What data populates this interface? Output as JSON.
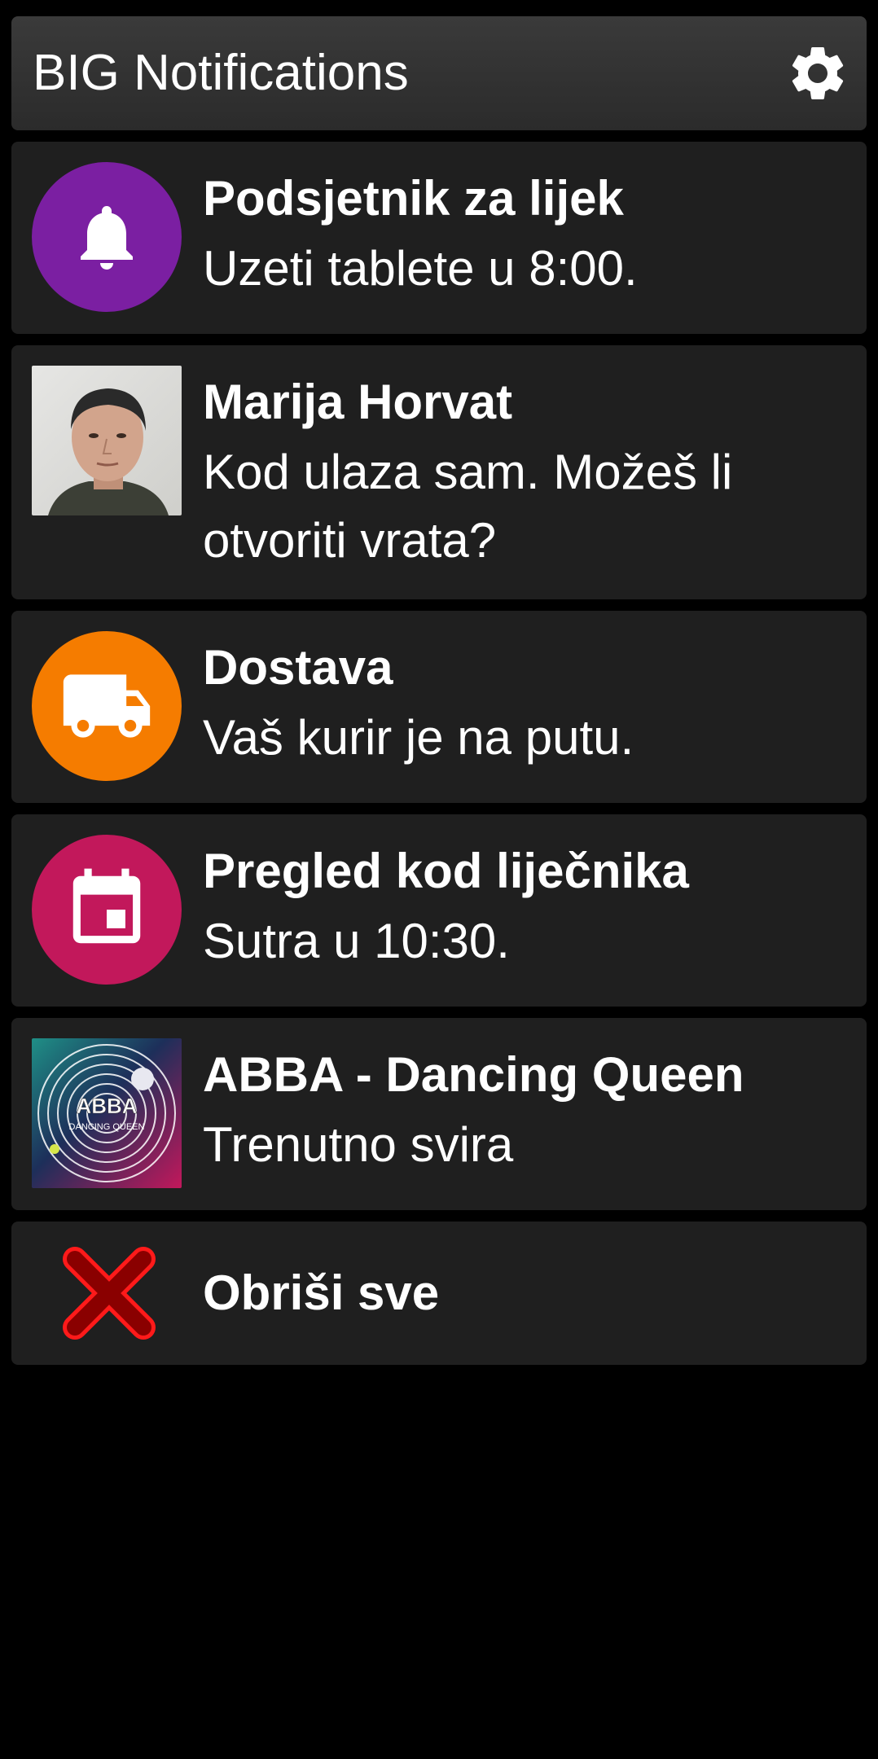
{
  "header": {
    "title": "BIG Notifications",
    "settings_icon": "gear-icon"
  },
  "notifications": [
    {
      "title": "Podsjetnik za lijek",
      "body": "Uzeti tablete u 8:00.",
      "icon": "bell-icon",
      "icon_color": "#7b1fa2"
    },
    {
      "title": "Marija Horvat",
      "body": "Kod ulaza sam. Možeš li otvoriti vrata?",
      "icon": "avatar-photo"
    },
    {
      "title": "Dostava",
      "body": "Vaš kurir je na putu.",
      "icon": "truck-icon",
      "icon_color": "#f57c00"
    },
    {
      "title": "Pregled kod liječnika",
      "body": "Sutra u 10:30.",
      "icon": "calendar-icon",
      "icon_color": "#c2185b"
    },
    {
      "title": "ABBA - Dancing Queen",
      "body": "Trenutno svira",
      "icon": "album-art",
      "art_text": "ABBA",
      "art_subtext": "DANCING QUEEN"
    }
  ],
  "clear_all": {
    "label": "Obriši sve",
    "icon": "close-x-icon",
    "icon_color": "#e00000"
  }
}
